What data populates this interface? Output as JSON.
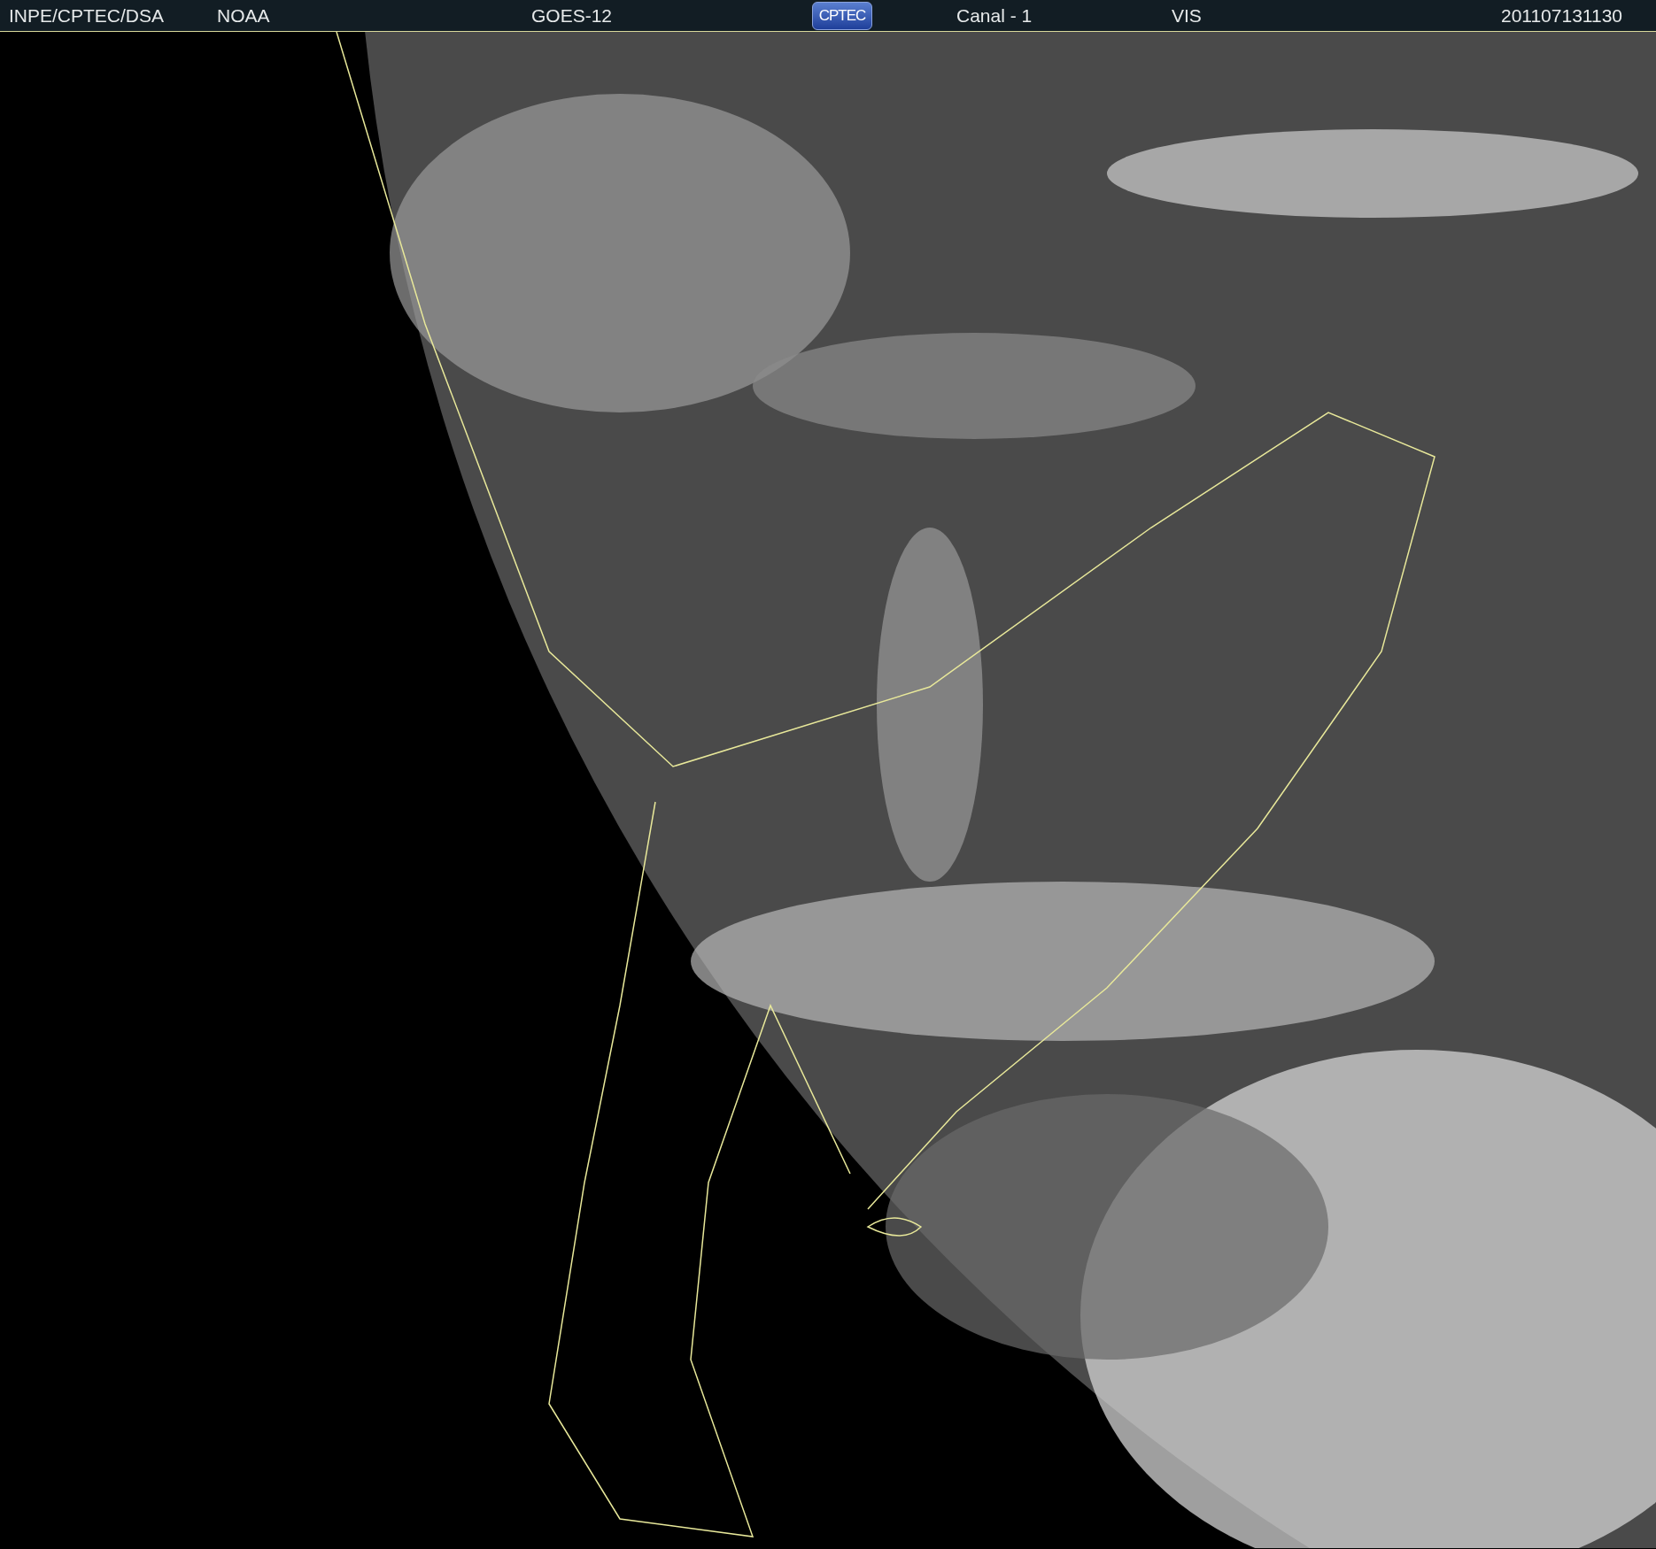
{
  "header": {
    "items": [
      {
        "kind": "text",
        "text": "INPE/CPTEC/DSA"
      },
      {
        "kind": "text",
        "text": "NOAA"
      },
      {
        "kind": "text",
        "text": "GOES-12"
      },
      {
        "kind": "logo",
        "text": "CPTEC"
      },
      {
        "kind": "text",
        "text": "Canal - 1"
      },
      {
        "kind": "text",
        "text": "VIS"
      },
      {
        "kind": "text",
        "text": "201107131130"
      }
    ]
  }
}
